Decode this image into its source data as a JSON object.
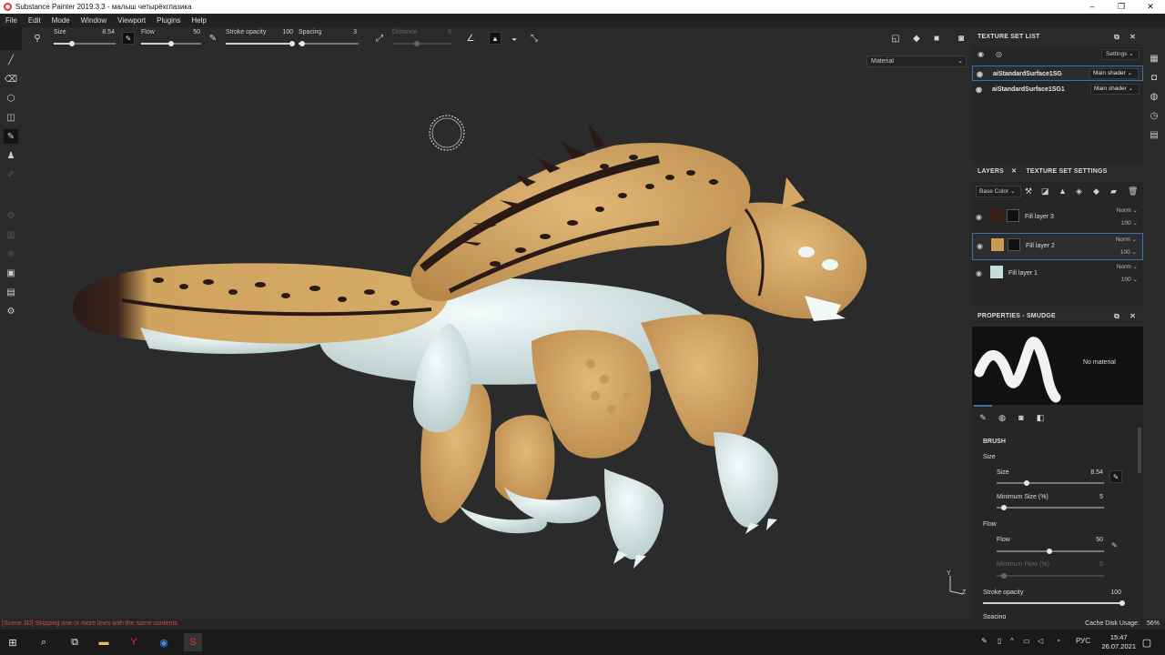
{
  "window": {
    "title": "Substance Painter 2019.3.3 - малыш четырёхглазика",
    "controls": [
      "–",
      "❐",
      "✕"
    ]
  },
  "menu": [
    "File",
    "Edit",
    "Mode",
    "Window",
    "Viewport",
    "Plugins",
    "Help"
  ],
  "tool_options": {
    "size_label": "Size",
    "size_value": "8.54",
    "flow_label": "Flow",
    "flow_value": "50",
    "stroke_opacity_label": "Stroke opacity",
    "stroke_opacity_value": "100",
    "spacing_label": "Spacing",
    "spacing_value": "3",
    "distance_label": "Distance",
    "distance_value": "8"
  },
  "viewport": {
    "display_mode": "Material",
    "axis_y": "Y",
    "axis_z": "Z"
  },
  "texture_set_list": {
    "title": "TEXTURE SET LIST",
    "settings_label": "Settings",
    "sets": [
      {
        "name": "aiStandardSurface1SG",
        "shader": "Main shader"
      },
      {
        "name": "aiStandardSurface1SG1",
        "shader": "Main shader"
      }
    ]
  },
  "layers": {
    "tab_layers": "LAYERS",
    "tab_texture_set_settings": "TEXTURE SET SETTINGS",
    "channel": "Base Color",
    "items": [
      {
        "name": "Fill layer 3",
        "blend": "Norm",
        "opacity": "100",
        "color": "#3a1f18"
      },
      {
        "name": "Fill layer 2",
        "blend": "Norm",
        "opacity": "100",
        "color": "#c89a55"
      },
      {
        "name": "Fill layer 1",
        "blend": "Norm",
        "opacity": "100",
        "color": "#c9dcdc"
      }
    ]
  },
  "properties": {
    "title": "PROPERTIES - SMUDGE",
    "no_material": "No material",
    "brush_heading": "BRUSH",
    "size_group": "Size",
    "size_label": "Size",
    "size_value": "8.54",
    "min_size_label": "Minimum Size (%)",
    "min_size_value": "5",
    "flow_group": "Flow",
    "flow_label": "Flow",
    "flow_value": "50",
    "min_flow_label": "Minimum Flow (%)",
    "min_flow_value": "5",
    "stroke_opacity_label": "Stroke opacity",
    "stroke_opacity_value": "100",
    "spacing_label": "Spacing"
  },
  "status": {
    "message": "[Scene 3D] Skipping one or more lines with the same contents",
    "cache_label": "Cache Disk Usage:",
    "cache_value": "56%"
  },
  "taskbar": {
    "lang": "РУС",
    "time": "15:47",
    "date": "26.07.2021"
  },
  "colors": {
    "accent": "#3b6fb5",
    "error": "#d24a3a",
    "creature_yellow": "#d4a862",
    "creature_white": "#dfeeee",
    "creature_dark": "#2a1a16"
  }
}
